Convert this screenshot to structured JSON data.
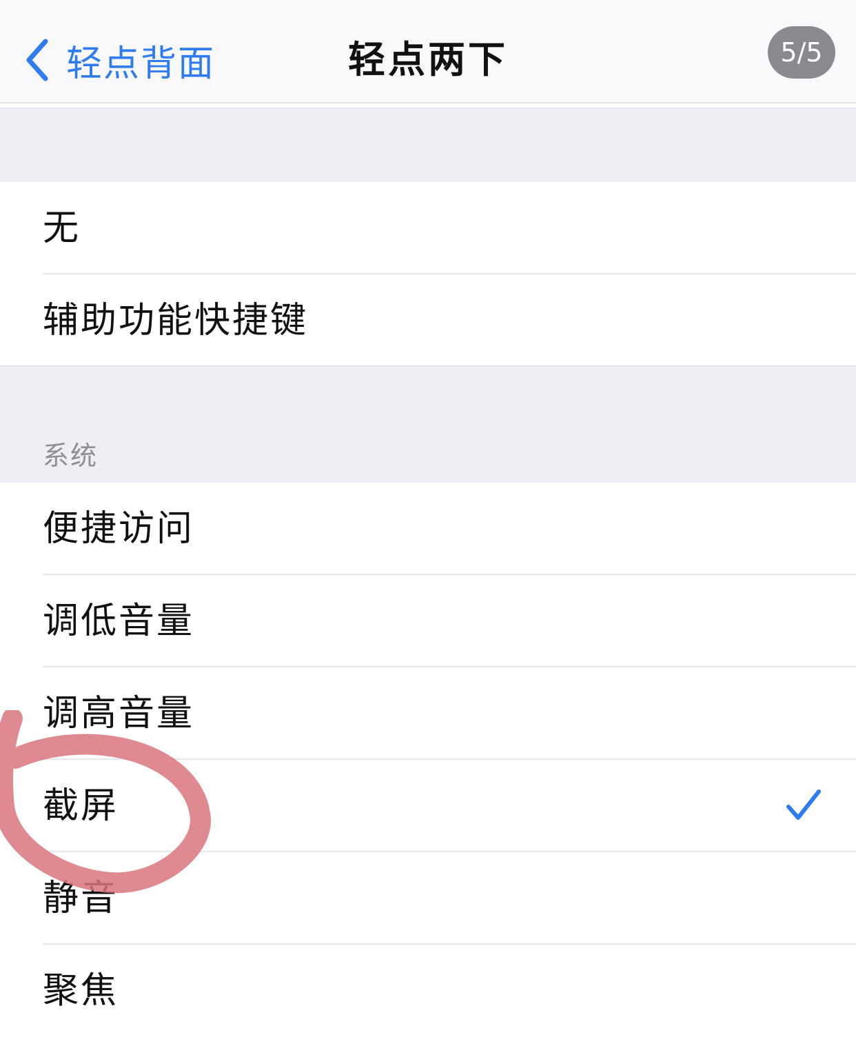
{
  "navbar": {
    "back_label": "轻点背面",
    "title": "轻点两下",
    "page_indicator": "5/5",
    "back_icon": "chevron-left-icon"
  },
  "top_group": {
    "items": [
      {
        "label": "无"
      },
      {
        "label": "辅助功能快捷键"
      }
    ]
  },
  "system_group": {
    "header": "系统",
    "items": [
      {
        "label": "便捷访问"
      },
      {
        "label": "调低音量"
      },
      {
        "label": "调高音量"
      },
      {
        "label": "截屏",
        "selected": true
      },
      {
        "label": "静音"
      },
      {
        "label": "聚焦"
      }
    ]
  },
  "colors": {
    "accent": "#2f7cf0",
    "annotation": "#d9767e",
    "badge": "#8a8a8e"
  }
}
